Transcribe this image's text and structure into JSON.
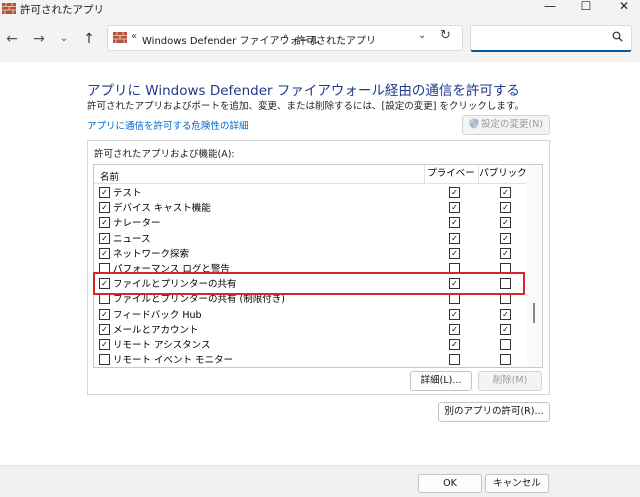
{
  "window": {
    "title": "許可されたアプリ",
    "minimize": "—",
    "maximize": "☐",
    "close": "✕"
  },
  "address": {
    "overflow": "«",
    "crumbs": [
      "Windows Defender ファイアウォール",
      "許可されたアプリ"
    ],
    "separator": "›"
  },
  "search": {
    "placeholder": ""
  },
  "page": {
    "heading": "アプリに Windows Defender ファイアウォール経由の通信を許可する",
    "description": "許可されたアプリおよびポートを追加、変更、または削除するには、[設定の変更] をクリックします。",
    "risk_link": "アプリに通信を許可する危険性の詳細",
    "change_settings": "設定の変更(N)"
  },
  "list": {
    "group_label": "許可されたアプリおよび機能(A):",
    "headers": {
      "name": "名前",
      "private": "プライベート",
      "public": "パブリック"
    },
    "rows": [
      {
        "name": "テスト",
        "enabled": true,
        "private": true,
        "public": true
      },
      {
        "name": "デバイス キャスト機能",
        "enabled": true,
        "private": true,
        "public": true
      },
      {
        "name": "ナレーター",
        "enabled": true,
        "private": true,
        "public": true
      },
      {
        "name": "ニュース",
        "enabled": true,
        "private": true,
        "public": true
      },
      {
        "name": "ネットワーク探索",
        "enabled": true,
        "private": true,
        "public": true
      },
      {
        "name": "パフォーマンス ログと警告",
        "enabled": false,
        "private": false,
        "public": false
      },
      {
        "name": "ファイルとプリンターの共有",
        "enabled": true,
        "private": true,
        "public": false
      },
      {
        "name": "ファイルとプリンターの共有 (制限付き)",
        "enabled": false,
        "private": false,
        "public": false
      },
      {
        "name": "フィードバック Hub",
        "enabled": true,
        "private": true,
        "public": true
      },
      {
        "name": "メールとアカウント",
        "enabled": true,
        "private": true,
        "public": true
      },
      {
        "name": "リモート アシスタンス",
        "enabled": true,
        "private": true,
        "public": false
      },
      {
        "name": "リモート イベント モニター",
        "enabled": false,
        "private": false,
        "public": false
      }
    ]
  },
  "buttons": {
    "details": "詳細(L)...",
    "remove": "削除(M)",
    "allow_other": "別のアプリの許可(R)...",
    "ok": "OK",
    "cancel": "キャンセル"
  },
  "colors": {
    "highlight": "#d9252a",
    "heading": "#1e3a8a",
    "link": "#0066cc"
  }
}
